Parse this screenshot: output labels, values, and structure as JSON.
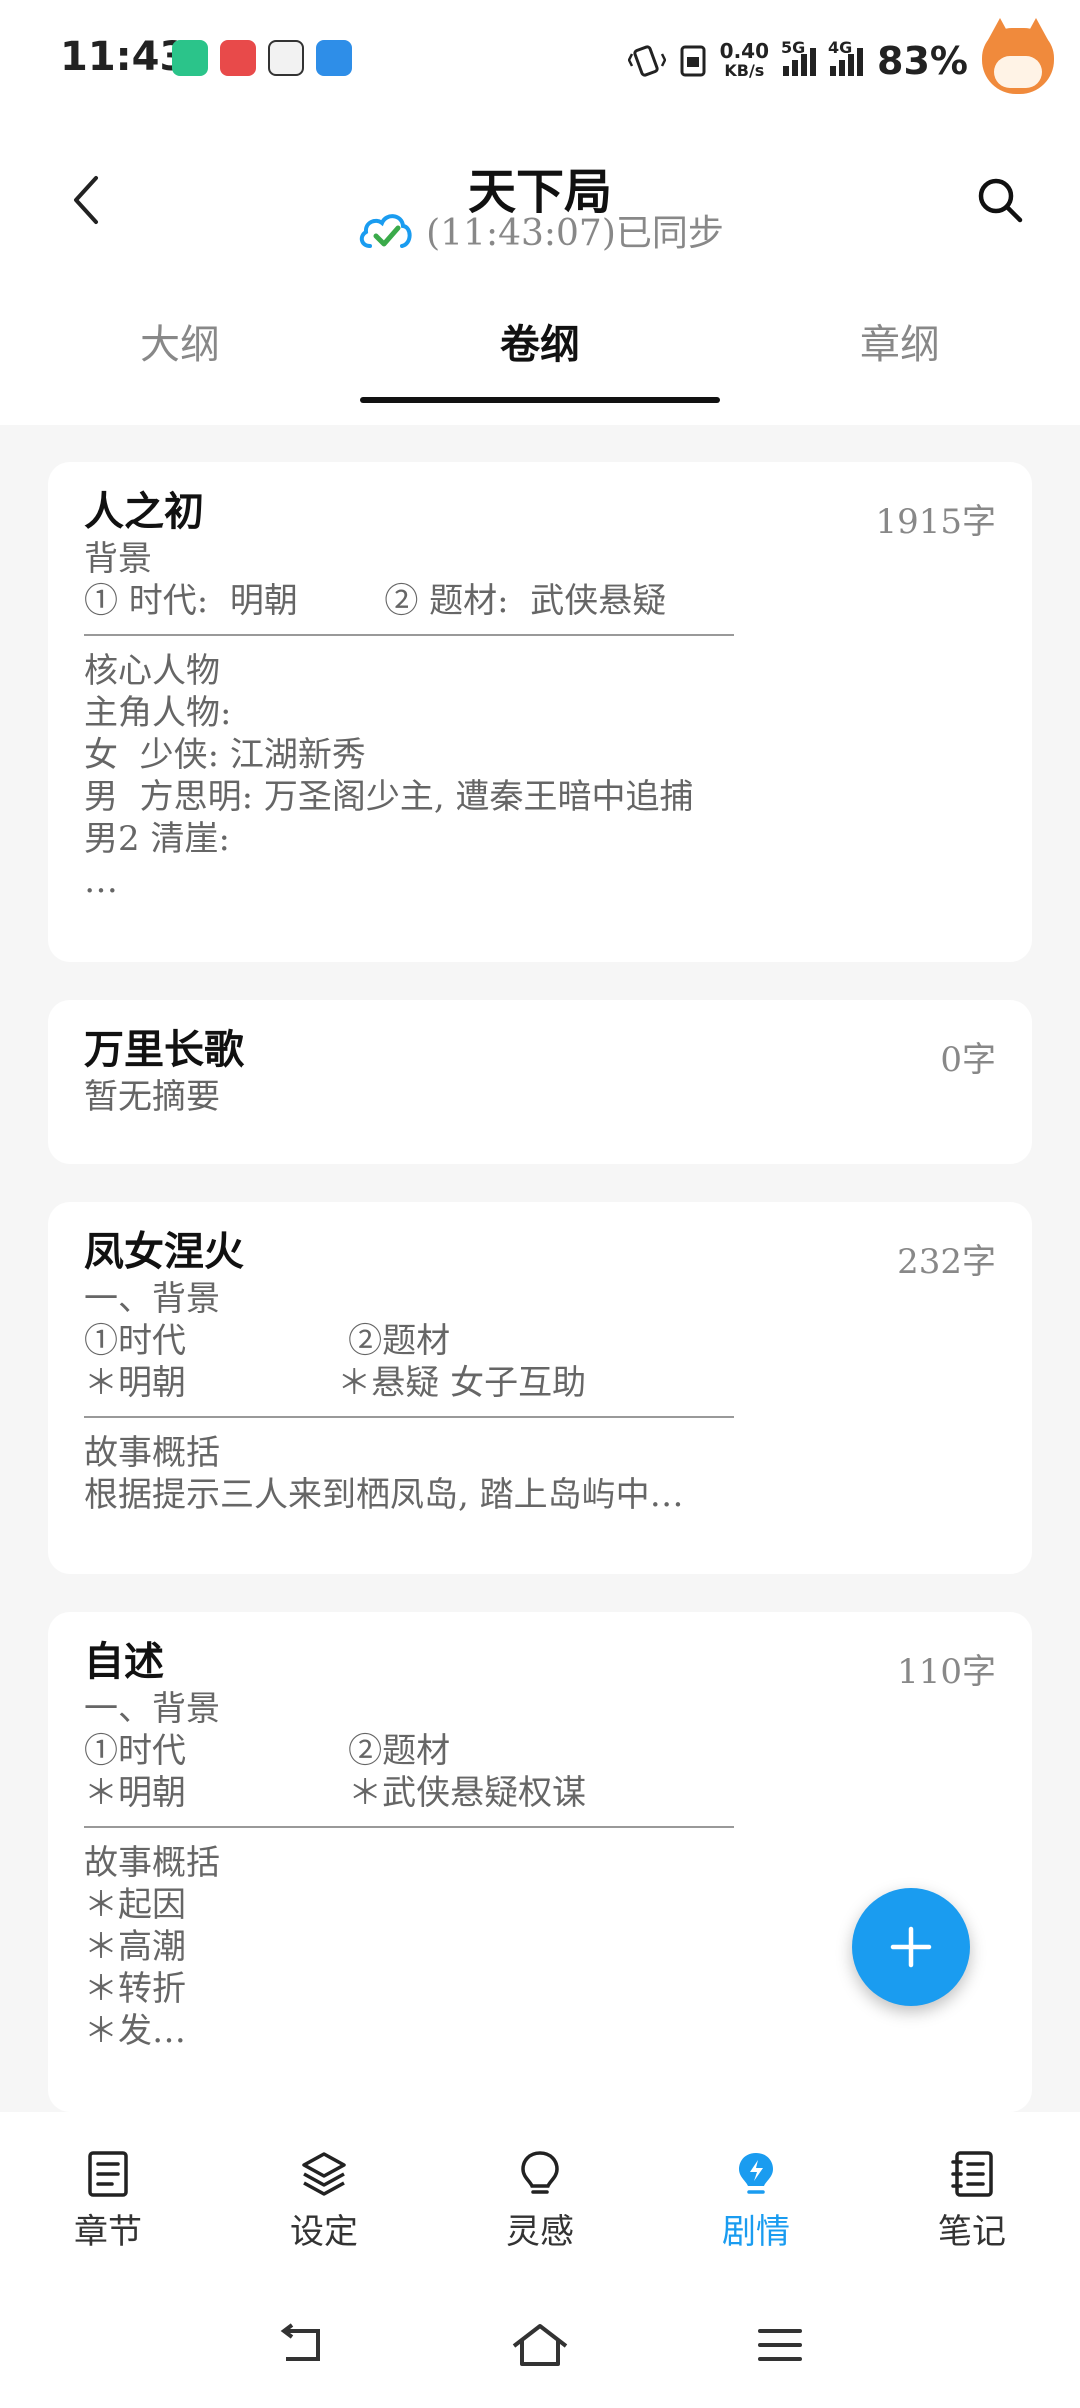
{
  "status_bar": {
    "time": "11:43",
    "net_speed": "0.40",
    "net_unit": "KB/s",
    "sig1_label": "5G",
    "sig2_label": "4G",
    "battery": "83%"
  },
  "header": {
    "title": "天下局",
    "sync_text": "(11:43:07)已同步"
  },
  "tabs": [
    "大纲",
    "卷纲",
    "章纲"
  ],
  "active_tab": 1,
  "cards": [
    {
      "title": "人之初",
      "count": "1915字",
      "lines_a": [
        "背景",
        "① 时代:  明朝        ② 题材:  武侠悬疑"
      ],
      "lines_b": [
        "核心人物",
        "主角人物:",
        "女  少侠: 江湖新秀",
        "男  方思明: 万圣阁少主, 遭秦王暗中追捕",
        "男2 清崖:",
        "…"
      ]
    },
    {
      "title": "万里长歌",
      "count": "0字",
      "lines_a": [
        "暂无摘要"
      ],
      "lines_b": []
    },
    {
      "title": "凤女涅火",
      "count": "232字",
      "lines_a": [
        "一、背景",
        "①时代               ②题材",
        "＊明朝              ＊悬疑 女子互助"
      ],
      "lines_b": [
        "故事概括",
        "根据提示三人来到栖凤岛, 踏上岛屿中…"
      ]
    },
    {
      "title": "自述",
      "count": "110字",
      "lines_a": [
        "一、背景",
        "①时代               ②题材",
        "＊明朝               ＊武侠悬疑权谋"
      ],
      "lines_b": [
        "故事概括",
        "＊起因",
        "＊高潮",
        "＊转折",
        "＊发…"
      ]
    }
  ],
  "bottom_nav": [
    {
      "label": "章节",
      "icon": "chapter-icon"
    },
    {
      "label": "设定",
      "icon": "layers-icon"
    },
    {
      "label": "灵感",
      "icon": "lightbulb-icon"
    },
    {
      "label": "剧情",
      "icon": "plot-icon"
    },
    {
      "label": "笔记",
      "icon": "notebook-icon"
    }
  ],
  "colors": {
    "accent": "#1a9cf0",
    "sync_green": "#3aaa4a",
    "muted_text": "#888888"
  }
}
